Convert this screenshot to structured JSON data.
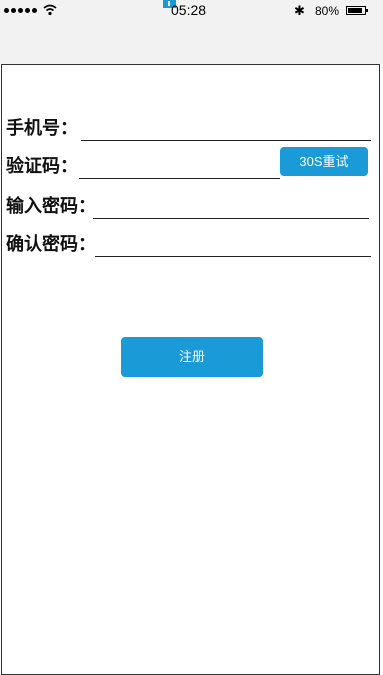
{
  "status_bar": {
    "time": "05:28",
    "battery_percent": "80%",
    "bluetooth_icon": "bluetooth-icon",
    "wifi_icon": "wifi-icon",
    "signal_icon": "signal-dots-icon"
  },
  "form": {
    "phone_label": "手机号：",
    "phone_value": "",
    "code_label": "验证码：",
    "code_value": "",
    "retry_label": "30S重试",
    "password_label": "输入密码：",
    "password_value": "",
    "confirm_label": "确认密码：",
    "confirm_value": "",
    "register_label": "注册"
  },
  "colors": {
    "accent": "#1a9ad7",
    "status_bg": "#f2f2f2"
  }
}
